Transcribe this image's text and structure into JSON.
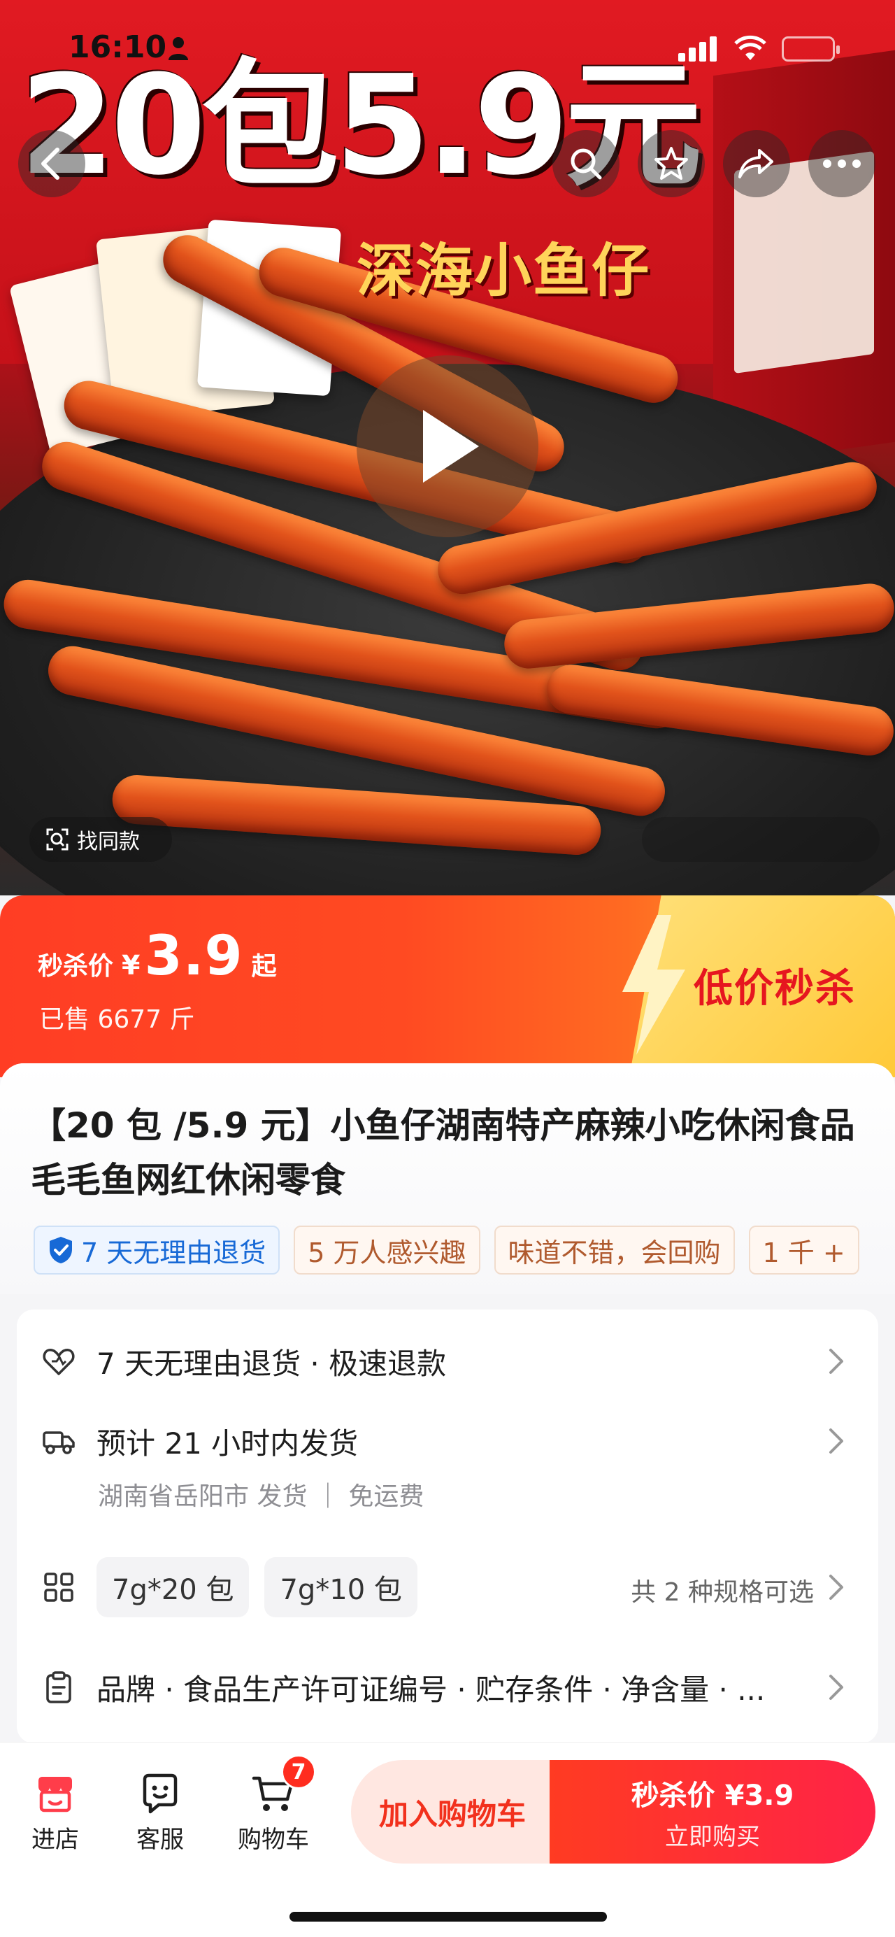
{
  "status_bar": {
    "time": "16:10"
  },
  "hero": {
    "headline": "20包5.9元",
    "subline": "深海小鱼仔",
    "find_same_label": "找同款"
  },
  "price_banner": {
    "label": "秒杀价",
    "currency": "¥",
    "price": "3.9",
    "suffix": "起",
    "sold": "已售 6677 斤",
    "flash_title": "低价秒杀"
  },
  "product": {
    "title": "【20 包 /5.9 元】小鱼仔湖南特产麻辣小吃休闲食品毛毛鱼网红休闲零食",
    "tags": [
      "7 天无理由退货",
      "5 万人感兴趣",
      "味道不错，会回购",
      "1 千 +"
    ]
  },
  "info": {
    "return_policy": "7 天无理由退货 · 极速退款",
    "shipping": "预计 21 小时内发货",
    "shipping_sub": "湖南省岳阳市 发货 ｜ 免运费",
    "specs": [
      "7g*20 包",
      "7g*10 包"
    ],
    "spec_count": "共 2 种规格可选",
    "params": "品牌 · 食品生产许可证编号 · 贮存条件 · 净含量 · ..."
  },
  "bottom_bar": {
    "store": "进店",
    "service": "客服",
    "cart": "购物车",
    "cart_badge": "7",
    "add_to_cart": "加入购物车",
    "buy_price": "秒杀价 ¥3.9",
    "buy_now": "立即购买"
  },
  "colors": {
    "accent": "#ff3d24",
    "flash_yellow": "#ffd14a",
    "tag_blue": "#1769d6"
  }
}
